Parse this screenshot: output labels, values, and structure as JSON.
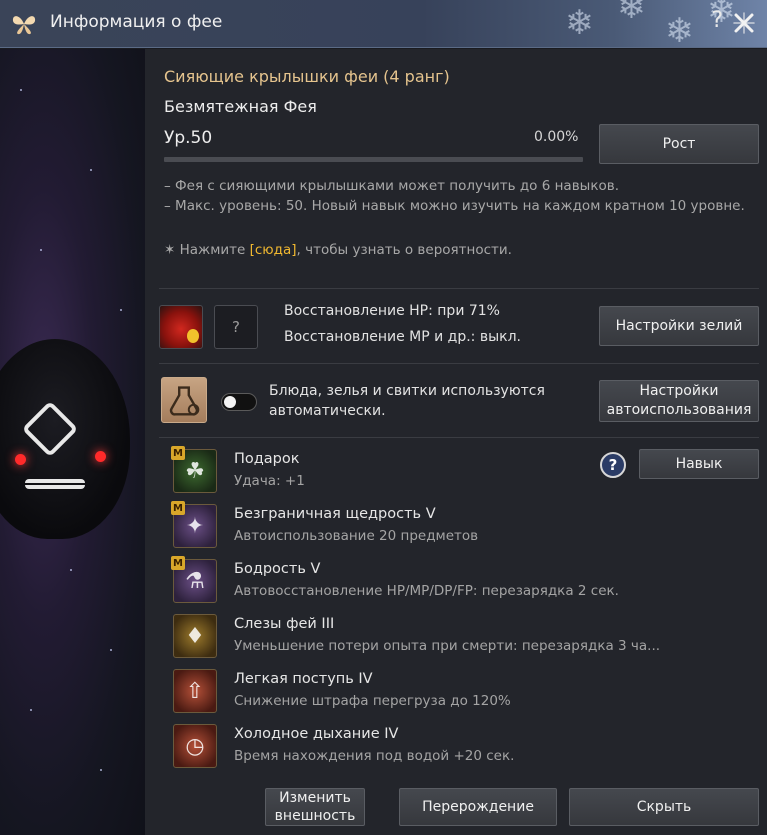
{
  "window": {
    "title": "Информация о фее"
  },
  "fairy": {
    "name": "Сияющие крылышки феи (4 ранг)",
    "type": "Безмятежная Фея",
    "level": "Ур.50",
    "exp_percent": "0.00%",
    "exp_fraction": 0.0,
    "grow_label": "Рост",
    "desc1": "– Фея с сияющими крылышками может получить до 6 навыков.",
    "desc2": "– Макс. уровень: 50. Новый навык можно изучить на каждом кратном 10 уровне.",
    "hint_prefix": "✶ Нажмите ",
    "hint_link": "[сюда]",
    "hint_suffix": ", чтобы узнать о вероятности."
  },
  "potions": {
    "hp_text": "Восстановление HP: при 71%",
    "mp_text": "Восстановление MP и др.: выкл.",
    "unknown_slot": "?",
    "settings_label": "Настройки зелий"
  },
  "auto_use": {
    "text": "Блюда, зелья и свитки используются автоматически.",
    "toggle_on": false,
    "settings_label": "Настройки автоиспользования"
  },
  "skills": {
    "help": "?",
    "skill_button": "Навык",
    "badge": "M",
    "items": [
      {
        "name": "Подарок",
        "desc": "Удача: +1"
      },
      {
        "name": "Безграничная щедрость V",
        "desc": "Автоиспользование 20 предметов"
      },
      {
        "name": "Бодрость V",
        "desc": "Автовосстановление HP/MP/DP/FP: перезарядка 2 сек."
      },
      {
        "name": "Слезы фей III",
        "desc": "Уменьшение потери опыта при смерти: перезарядка 3 ча..."
      },
      {
        "name": "Легкая поступь IV",
        "desc": "Снижение штрафа перегруза до 120%"
      },
      {
        "name": "Холодное дыхание IV",
        "desc": "Время нахождения под водой +20 сек."
      }
    ]
  },
  "footer": {
    "appearance": "Изменить внешность",
    "rebirth": "Перерождение",
    "hide": "Скрыть"
  },
  "colors": {
    "accent_gold": "#e5c48e",
    "link_yellow": "#f0b830"
  }
}
